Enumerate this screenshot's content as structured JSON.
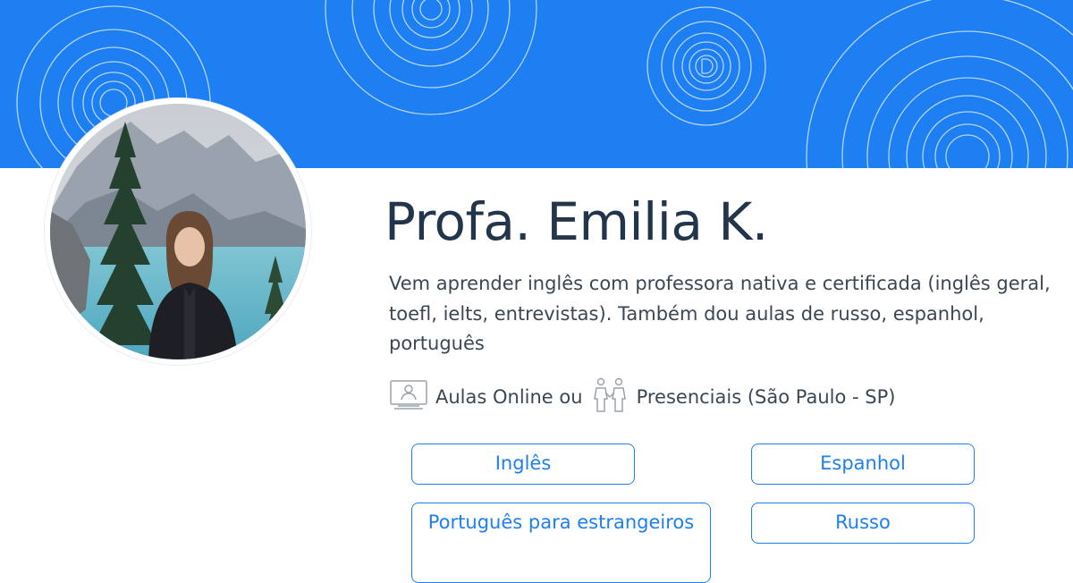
{
  "theme": {
    "accent": "#1d7ff2",
    "text_dark": "#23354a",
    "text_body": "#3b4754",
    "background": "#ffffff"
  },
  "banner": {
    "pattern_icon": "concentric-d-logo-pattern"
  },
  "profile": {
    "name": "Profa. Emilia K.",
    "photo": "profile-photo-mountain-lake",
    "description": "Vem aprender inglês com professora nativa e certificada (inglês geral, toefl, ielts, entrevistas). Também dou aulas de russo, espanhol, português"
  },
  "lesson_modes": {
    "online_icon": "computer-screen-user-icon",
    "online_text": "Aulas Online ou",
    "in_person_icon": "two-people-icon",
    "in_person_text": "Presenciais (São Paulo - SP)"
  },
  "subjects": [
    {
      "label": "Inglês"
    },
    {
      "label": "Espanhol"
    },
    {
      "label": "Português para estrangeiros"
    },
    {
      "label": "Russo"
    }
  ]
}
